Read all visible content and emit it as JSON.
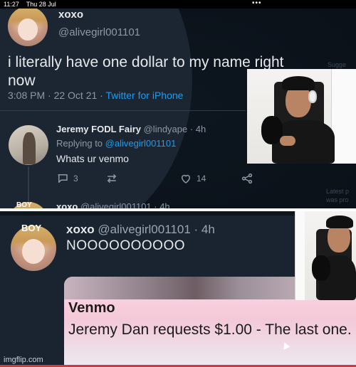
{
  "status_bar": {
    "time": "11:27",
    "date": "Thu 28 Jul",
    "dots": "•••"
  },
  "tweet": {
    "name": "xoxo",
    "handle": "@alivegirl001101",
    "text_line1": "i literally have one dollar to my name right",
    "text_line2": "now",
    "time": "3:08 PM · 22 Oct 21 · ",
    "source": "Twitter for iPhone"
  },
  "reply": {
    "name": "Jeremy FODL Fairy",
    "handle": "@lindyape · 4h",
    "replying_prefix": "Replying to ",
    "replying_handle": "@alivegirl001101",
    "text": "Whats ur venmo",
    "actions": {
      "replies": "3",
      "retweets": "",
      "likes": "14"
    }
  },
  "cropped_next": {
    "name": "xoxo",
    "handle": "@alivegirl001101 · 4h",
    "avatar_text": "BOY"
  },
  "side_overlay": {
    "label1": "Sugge",
    "label2": "Latest p",
    "label3": "was pro"
  },
  "panel2": {
    "avatar_text": "BOY",
    "name": "xoxo",
    "handle": "@alivegirl001101 · 4h",
    "text": "NOOOOOOOOOO",
    "card_title": "Venmo",
    "card_text": "Jeremy Dan requests $1.00 - The last one."
  },
  "watermark": "imgflip.com",
  "colors": {
    "bg": "#15202b",
    "accent": "#1d9bf0",
    "text": "#e7e9ea",
    "muted": "#8b98a5",
    "card_bg": "#f3c9d8"
  }
}
